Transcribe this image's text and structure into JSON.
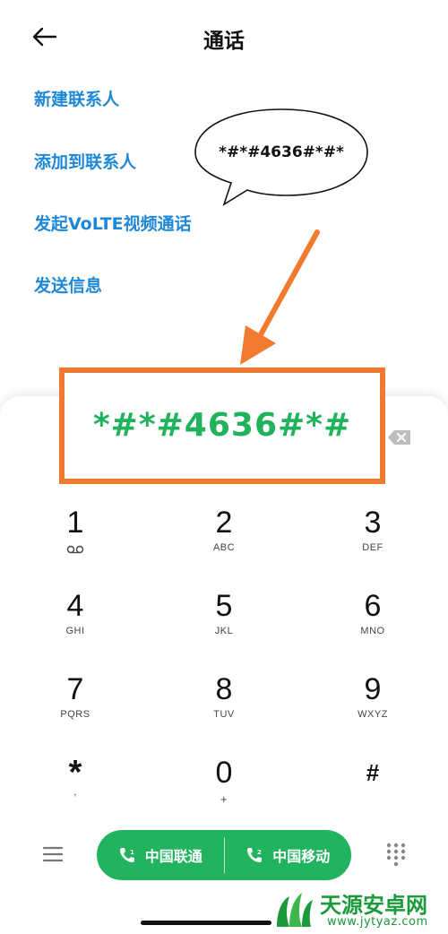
{
  "header": {
    "title": "通话",
    "back_icon": "back-arrow-icon"
  },
  "actions": [
    {
      "label": "新建联系人"
    },
    {
      "label": "添加到联系人"
    },
    {
      "label": "发起VoLTE视频通话"
    },
    {
      "label": "发送信息"
    }
  ],
  "callout": {
    "text": "*#*#4636#*#*"
  },
  "dialer": {
    "number": "*#*#4636#*#",
    "backspace_icon": "backspace-icon",
    "keys": [
      {
        "digit": "1",
        "letters": ""
      },
      {
        "digit": "2",
        "letters": "ABC"
      },
      {
        "digit": "3",
        "letters": "DEF"
      },
      {
        "digit": "4",
        "letters": "GHI"
      },
      {
        "digit": "5",
        "letters": "JKL"
      },
      {
        "digit": "6",
        "letters": "MNO"
      },
      {
        "digit": "7",
        "letters": "PQRS"
      },
      {
        "digit": "8",
        "letters": "TUV"
      },
      {
        "digit": "9",
        "letters": "WXYZ"
      },
      {
        "digit": "*",
        "letters": ","
      },
      {
        "digit": "0",
        "letters": "+"
      },
      {
        "digit": "#",
        "letters": ""
      }
    ]
  },
  "bottom_bar": {
    "menu_icon": "menu-icon",
    "sim1_label": "中国联通",
    "sim2_label": "中国移动",
    "keypad_icon": "keypad-grid-icon"
  },
  "watermark": {
    "name": "天源安卓网",
    "url": "www.jytyaz.com"
  },
  "colors": {
    "accent_blue": "#1e88d6",
    "call_green": "#22b35e",
    "number_green": "#21b35c",
    "highlight_orange": "#f07a2e"
  }
}
